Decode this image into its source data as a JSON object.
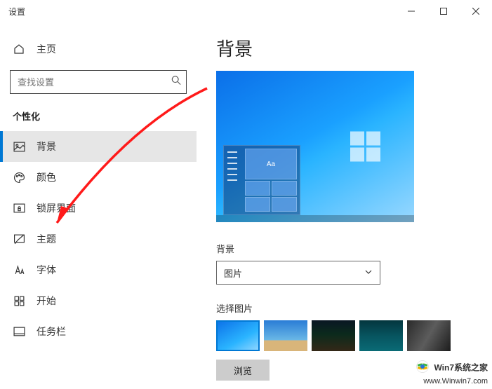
{
  "window": {
    "title": "设置"
  },
  "sidebar": {
    "home": "主页",
    "search_placeholder": "查找设置",
    "section": "个性化",
    "items": [
      {
        "label": "背景"
      },
      {
        "label": "颜色"
      },
      {
        "label": "锁屏界面"
      },
      {
        "label": "主题"
      },
      {
        "label": "字体"
      },
      {
        "label": "开始"
      },
      {
        "label": "任务栏"
      }
    ]
  },
  "main": {
    "title": "背景",
    "preview_sample": "Aa",
    "bg_label": "背景",
    "bg_dropdown_value": "图片",
    "choose_label": "选择图片",
    "browse": "浏览"
  },
  "watermark": {
    "line1": "Win7系统之家",
    "line2": "www.Winwin7.com"
  }
}
